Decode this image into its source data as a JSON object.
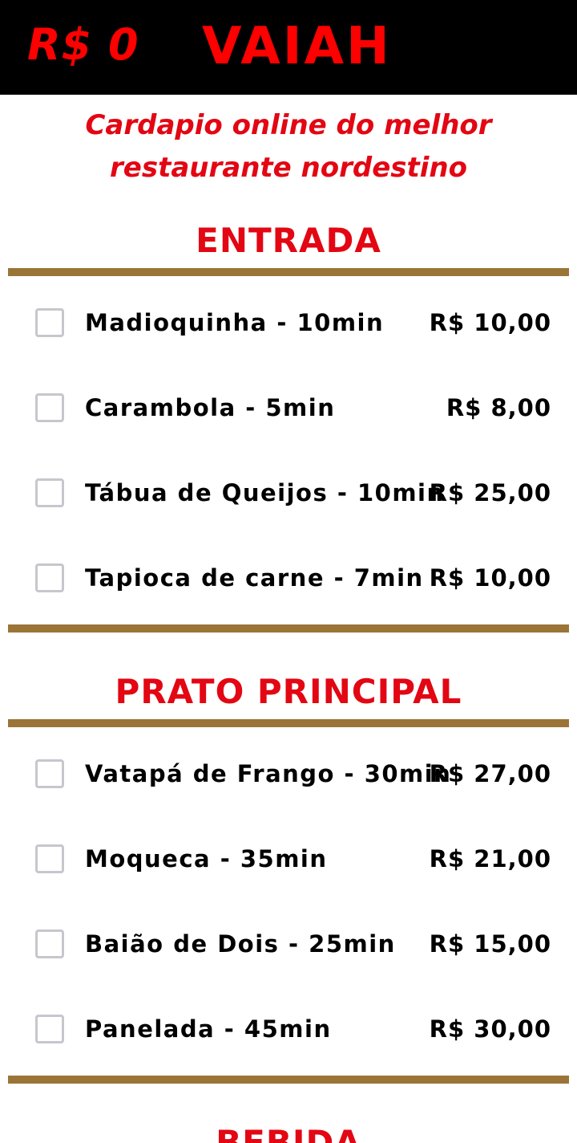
{
  "header": {
    "cart_total": "R$ 0",
    "brand": "VAIAH"
  },
  "tagline": "Cardapio online do melhor restaurante nordestino",
  "sections": [
    {
      "title": "ENTRADA",
      "items": [
        {
          "name": "Madioquinha - 10min",
          "price": "R$ 10,00",
          "checked": false
        },
        {
          "name": "Carambola - 5min",
          "price": "R$ 8,00",
          "checked": false
        },
        {
          "name": "Tábua de Queijos - 10min",
          "price": "R$ 25,00",
          "checked": false
        },
        {
          "name": "Tapioca de carne - 7min",
          "price": "R$ 10,00",
          "checked": false
        }
      ]
    },
    {
      "title": "PRATO PRINCIPAL",
      "items": [
        {
          "name": "Vatapá de Frango - 30min",
          "price": "R$ 27,00",
          "checked": false
        },
        {
          "name": "Moqueca - 35min",
          "price": "R$ 21,00",
          "checked": false
        },
        {
          "name": "Baião de Dois - 25min",
          "price": "R$ 15,00",
          "checked": false
        },
        {
          "name": "Panelada - 45min",
          "price": "R$ 30,00",
          "checked": false
        }
      ]
    },
    {
      "title": "BEBIDA",
      "items": []
    }
  ],
  "colors": {
    "header_bg": "#000000",
    "accent_red": "#e30613",
    "rule_brown": "#9a7537",
    "checkbox_border": "#c8c6cd"
  }
}
